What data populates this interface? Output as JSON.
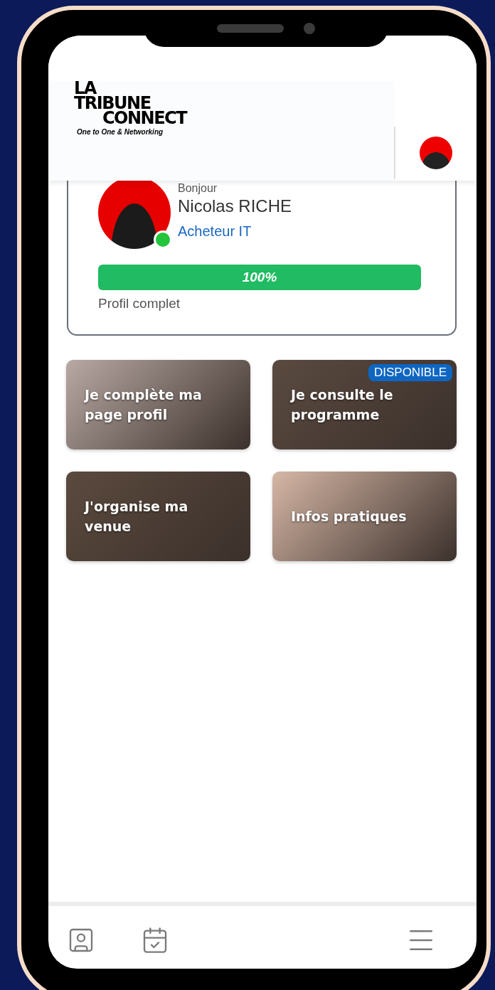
{
  "header": {
    "logo": {
      "line_1": "LA",
      "line_2": "TRIBUNE",
      "line_3": "CONNECT",
      "tagline": "One to One & Networking"
    }
  },
  "profile": {
    "greeting": "Bonjour",
    "name": "Nicolas RICHE",
    "role": "Acheteur IT",
    "online": true,
    "progress": {
      "level": 1,
      "label": "100%"
    },
    "status": "Profil complet"
  },
  "tiles": [
    {
      "title": "Je complète ma page profil"
    },
    {
      "title": "Je consulte le programme",
      "badge": "DISPONIBLE"
    },
    {
      "title": "J'organise ma venue"
    },
    {
      "title": "Infos pratiques"
    }
  ],
  "bottom_nav": [
    {
      "kind": "profile"
    },
    {
      "kind": "calendar"
    },
    {
      "kind": "menu"
    }
  ]
}
